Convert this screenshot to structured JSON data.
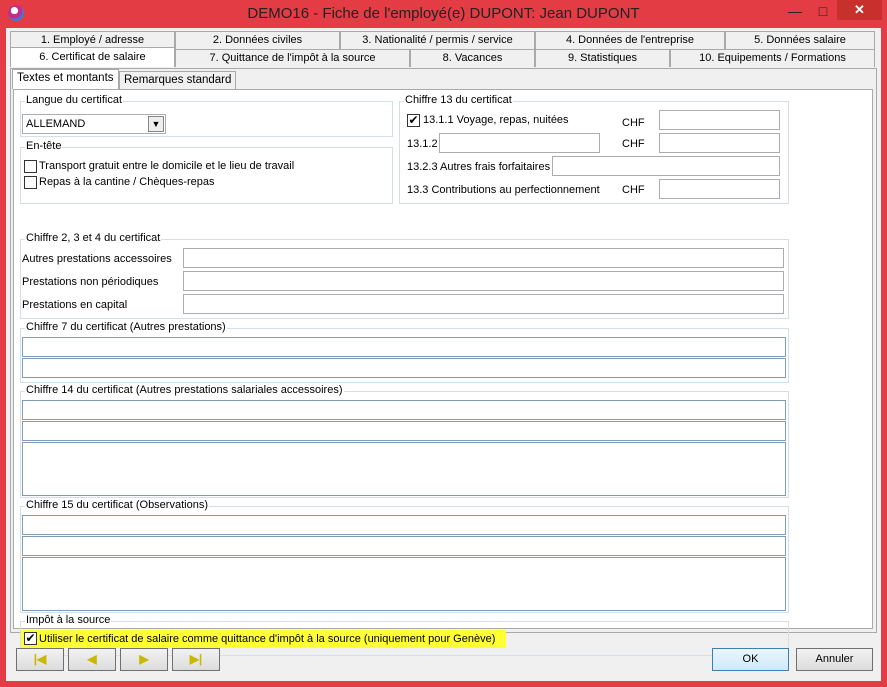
{
  "window": {
    "title": "DEMO16 - Fiche de l'employé(e) DUPONT:  Jean DUPONT",
    "minimize": "—",
    "maximize": "□",
    "close": "✕"
  },
  "tabs_row1": [
    "1. Employé / adresse",
    "2. Données civiles",
    "3. Nationalité / permis / service",
    "4. Données de l'entreprise",
    "5. Données salaire"
  ],
  "tabs_row2": [
    "6. Certificat de salaire",
    "7. Quittance de l'impôt à la source",
    "8. Vacances",
    "9. Statistiques",
    "10. Equipements / Formations"
  ],
  "subtabs": [
    "Textes et montants",
    "Remarques standard"
  ],
  "langue": {
    "label": "Langue du certificat",
    "value": "ALLEMAND"
  },
  "entete": {
    "label": "En-tête",
    "opt1": "Transport gratuit entre le domicile et le lieu de travail",
    "opt2": "Repas à la cantine / Chèques-repas",
    "opt1_checked": false,
    "opt2_checked": false
  },
  "chiffre13": {
    "label": "Chiffre 13 du certificat",
    "r1": "13.1.1 Voyage, repas, nuitées",
    "r1_checked": true,
    "r2": "13.1.2",
    "r3": "13.2.3 Autres frais forfaitaires",
    "r4": "13.3 Contributions au perfectionnement",
    "chf": "CHF"
  },
  "chiffre234": {
    "label": "Chiffre 2, 3 et 4 du certificat",
    "l1": "Autres prestations accessoires",
    "l2": "Prestations non périodiques",
    "l3": "Prestations en capital"
  },
  "chiffre7": {
    "label": "Chiffre 7 du certificat (Autres prestations)"
  },
  "chiffre14": {
    "label": "Chiffre 14 du certificat (Autres prestations salariales accessoires)"
  },
  "chiffre15": {
    "label": "Chiffre 15 du certificat (Observations)"
  },
  "impot": {
    "label": "Impôt à la source",
    "option": "Utiliser le certificat de salaire comme quittance d'impôt à la source (uniquement pour Genève)",
    "checked": true,
    "highlight": "#ffff33"
  },
  "nav": {
    "first": "|◀",
    "prev": "◀",
    "next": "▶",
    "last": "▶|"
  },
  "buttons": {
    "ok": "OK",
    "cancel": "Annuler"
  },
  "colors": {
    "titlebar": "#e33c45",
    "close": "#c7302d",
    "arrow": "#f2e200"
  }
}
